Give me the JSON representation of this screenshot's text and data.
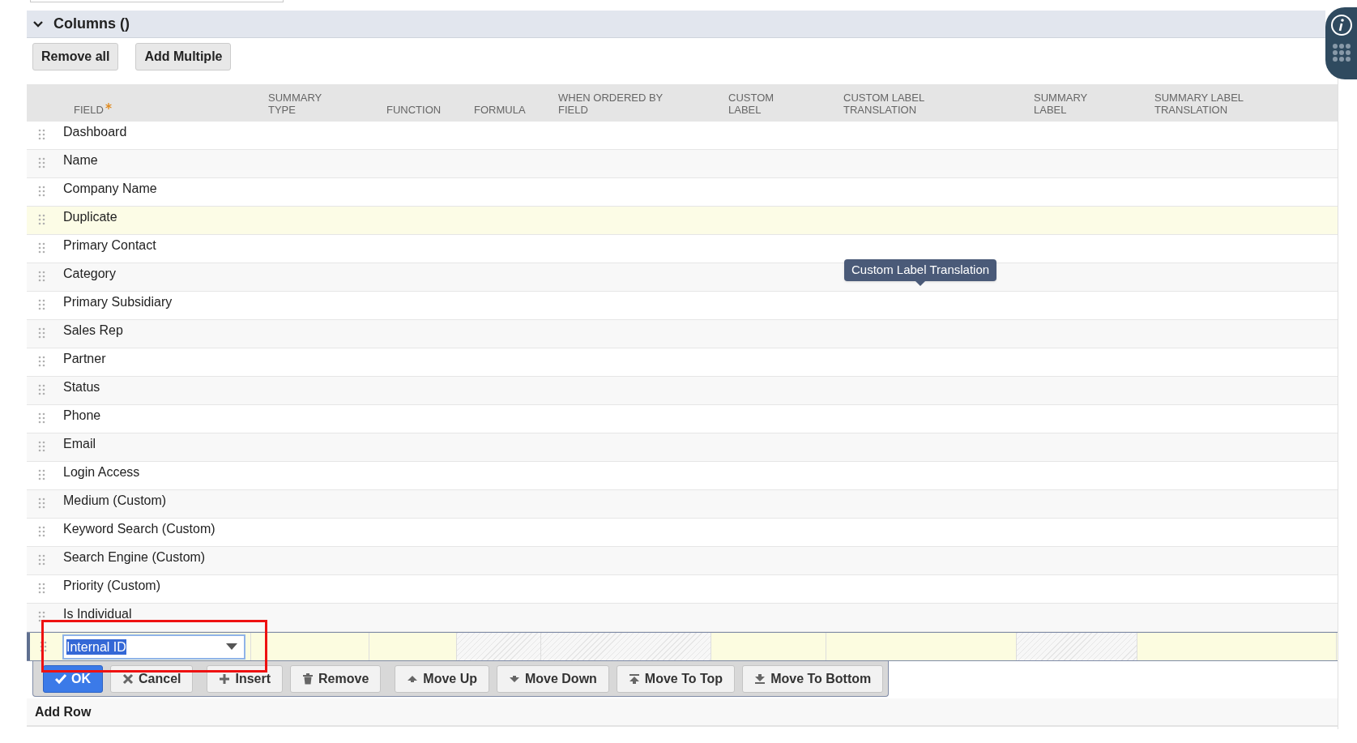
{
  "section": {
    "title": "Columns ()",
    "expanded": true
  },
  "toolbar_buttons": [
    "Remove all",
    "Add Multiple"
  ],
  "table": {
    "columns": [
      {
        "label": "FIELD",
        "required": true
      },
      {
        "label": "SUMMARY\nTYPE",
        "required": false
      },
      {
        "label": "FUNCTION",
        "required": false
      },
      {
        "label": "FORMULA",
        "required": false
      },
      {
        "label": "WHEN ORDERED BY\nFIELD",
        "required": false
      },
      {
        "label": "CUSTOM\nLABEL",
        "required": false
      },
      {
        "label": "CUSTOM LABEL\nTRANSLATION",
        "required": false
      },
      {
        "label": "SUMMARY\nLABEL",
        "required": false
      },
      {
        "label": "SUMMARY LABEL\nTRANSLATION",
        "required": false
      }
    ],
    "rows": [
      {
        "field": "Dashboard",
        "highlighted": false
      },
      {
        "field": "Name",
        "highlighted": false
      },
      {
        "field": "Company Name",
        "highlighted": false
      },
      {
        "field": "Duplicate",
        "highlighted": true
      },
      {
        "field": "Primary Contact",
        "highlighted": false
      },
      {
        "field": "Category",
        "highlighted": false
      },
      {
        "field": "Primary Subsidiary",
        "highlighted": false
      },
      {
        "field": "Sales Rep",
        "highlighted": false
      },
      {
        "field": "Partner",
        "highlighted": false
      },
      {
        "field": "Status",
        "highlighted": false
      },
      {
        "field": "Phone",
        "highlighted": false
      },
      {
        "field": "Email",
        "highlighted": false
      },
      {
        "field": "Login Access",
        "highlighted": false
      },
      {
        "field": "Medium (Custom)",
        "highlighted": false
      },
      {
        "field": "Keyword Search (Custom)",
        "highlighted": false
      },
      {
        "field": "Search Engine (Custom)",
        "highlighted": false
      },
      {
        "field": "Priority (Custom)",
        "highlighted": false
      },
      {
        "field": "Is Individual",
        "highlighted": false
      }
    ]
  },
  "edit_row": {
    "field": "Internal ID",
    "cells": [
      {
        "disabled": false
      },
      {
        "disabled": false
      },
      {
        "disabled": true
      },
      {
        "disabled": true
      },
      {
        "disabled": false
      },
      {
        "disabled": false
      },
      {
        "disabled": true
      },
      {
        "disabled": false
      }
    ]
  },
  "row_actions": [
    {
      "label": "OK",
      "primary": true
    },
    {
      "label": "Cancel",
      "primary": false
    },
    {
      "label": "Insert",
      "primary": false
    },
    {
      "label": "Remove",
      "primary": false
    },
    {
      "label": "Move Up",
      "primary": false
    },
    {
      "label": "Move Down",
      "primary": false
    },
    {
      "label": "Move To Top",
      "primary": false
    },
    {
      "label": "Move To Bottom",
      "primary": false
    }
  ],
  "add_row": "Add Row",
  "tooltip": "Custom Label Translation"
}
